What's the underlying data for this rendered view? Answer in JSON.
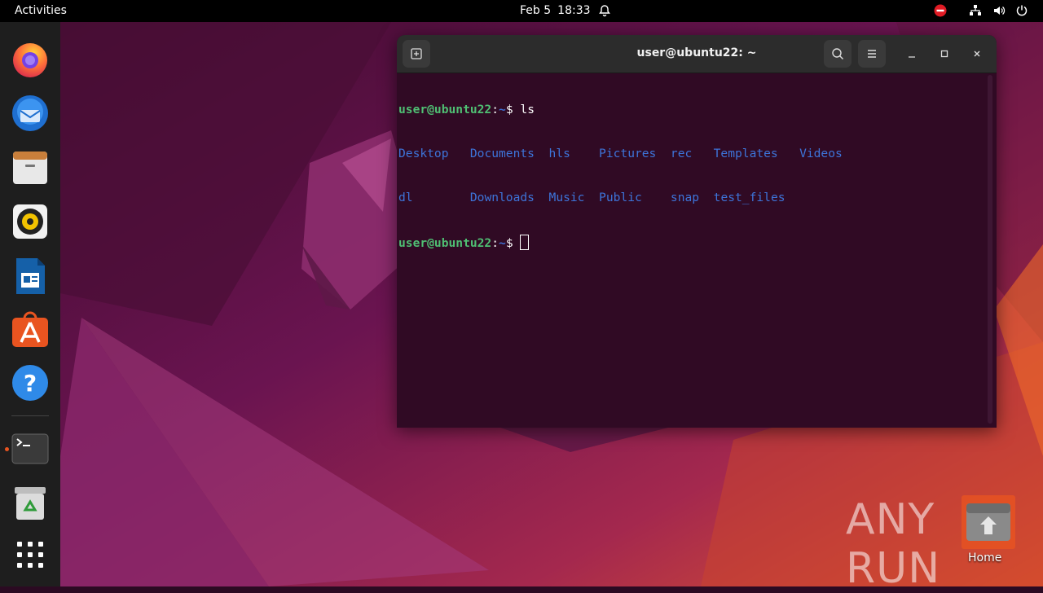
{
  "topbar": {
    "activities": "Activities",
    "date": "Feb 5",
    "time": "18:33",
    "icons": [
      "notification-bell-icon",
      "do-not-disturb-icon",
      "network-icon",
      "volume-icon",
      "power-icon"
    ]
  },
  "dock": {
    "items": [
      {
        "name": "firefox",
        "label": "Firefox"
      },
      {
        "name": "thunderbird",
        "label": "Thunderbird"
      },
      {
        "name": "files",
        "label": "Files"
      },
      {
        "name": "rhythmbox",
        "label": "Rhythmbox"
      },
      {
        "name": "libreoffice-writer",
        "label": "LibreOffice Writer"
      },
      {
        "name": "ubuntu-software",
        "label": "Ubuntu Software"
      },
      {
        "name": "help",
        "label": "Help"
      },
      {
        "name": "terminal",
        "label": "Terminal"
      },
      {
        "name": "trash",
        "label": "Trash"
      },
      {
        "name": "show-applications",
        "label": "Show Applications"
      }
    ]
  },
  "terminal": {
    "title": "user@ubuntu22: ~",
    "prompt_user": "user@ubuntu22",
    "prompt_colon": ":",
    "prompt_path": "~",
    "prompt_symbol": "$",
    "command": "ls",
    "listing_row1": [
      "Desktop",
      "Documents",
      "hls",
      "Pictures",
      "rec",
      "Templates",
      "Videos"
    ],
    "listing_row2": [
      "dl",
      "Downloads",
      "Music",
      "Public",
      "snap",
      "test_files"
    ]
  },
  "desktop": {
    "home_label": "Home",
    "watermark": "ANY RUN"
  },
  "colors": {
    "terminal_bg": "#300a24",
    "prompt_user": "#4fbf73",
    "prompt_path": "#3f6fd1",
    "directory": "#3d74d9",
    "accent": "#e95420"
  }
}
